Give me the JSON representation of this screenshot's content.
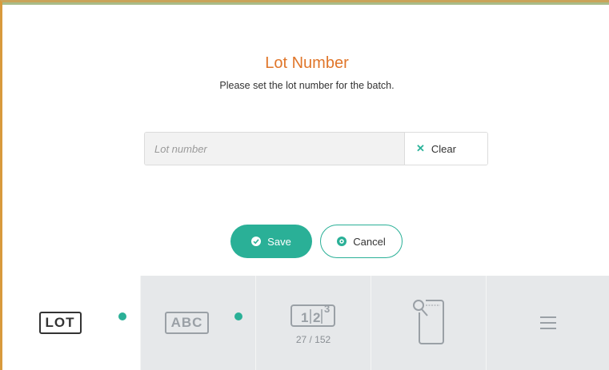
{
  "dialog": {
    "title": "Lot Number",
    "subtitle": "Please set the lot number for the batch."
  },
  "lot_field": {
    "placeholder": "Lot number",
    "value": "",
    "clear_label": "Clear"
  },
  "actions": {
    "save_label": "Save",
    "cancel_label": "Cancel"
  },
  "tabs": [
    {
      "label": "LOT",
      "icon": "lot-icon",
      "active": true,
      "has_dot": true
    },
    {
      "label": "ABC",
      "icon": "abc-icon",
      "active": false,
      "has_dot": true
    },
    {
      "label": "1|2|3",
      "icon": "numbering-icon",
      "counter": "27 / 152",
      "active": false
    },
    {
      "label": "",
      "icon": "search-document-icon",
      "active": false
    },
    {
      "label": "",
      "icon": "menu-icon",
      "active": false
    }
  ],
  "colors": {
    "accent": "#2ab097",
    "title": "#e0762a",
    "tabbar_bg": "#e6e8ea"
  }
}
